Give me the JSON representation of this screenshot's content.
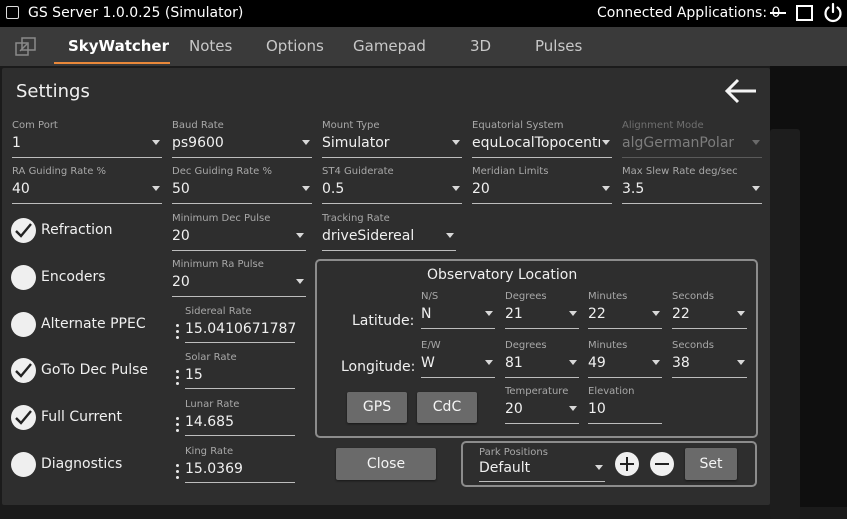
{
  "window": {
    "title": "GS Server 1.0.0.25 (Simulator)",
    "connected_label": "Connected Applications: 0"
  },
  "nav": {
    "tabs": [
      "SkyWatcher",
      "Notes",
      "Options",
      "Gamepad",
      "3D",
      "Pulses"
    ],
    "active": "SkyWatcher",
    "accent_color": "#e9883a"
  },
  "panel": {
    "title": "Settings"
  },
  "fields": {
    "com_port": {
      "label": "Com Port",
      "value": "1"
    },
    "baud_rate": {
      "label": "Baud Rate",
      "value": "ps9600"
    },
    "mount_type": {
      "label": "Mount Type",
      "value": "Simulator"
    },
    "equatorial_system": {
      "label": "Equatorial System",
      "value": "equLocalTopocentri"
    },
    "alignment_mode": {
      "label": "Alignment Mode",
      "value": "algGermanPolar"
    },
    "ra_guiding_rate": {
      "label": "RA Guiding Rate %",
      "value": "40"
    },
    "dec_guiding_rate": {
      "label": "Dec Guiding Rate %",
      "value": "50"
    },
    "st4_guiderate": {
      "label": "ST4 Guiderate",
      "value": "0.5"
    },
    "meridian_limits": {
      "label": "Meridian Limits",
      "value": "20"
    },
    "max_slew_rate": {
      "label": "Max Slew Rate deg/sec",
      "value": "3.5"
    },
    "min_dec_pulse": {
      "label": "Minimum Dec Pulse",
      "value": "20"
    },
    "tracking_rate": {
      "label": "Tracking Rate",
      "value": "driveSidereal"
    },
    "min_ra_pulse": {
      "label": "Minimum Ra Pulse",
      "value": "20"
    },
    "sidereal_rate": {
      "label": "Sidereal Rate",
      "value": "15.0410671787"
    },
    "solar_rate": {
      "label": "Solar Rate",
      "value": "15"
    },
    "lunar_rate": {
      "label": "Lunar Rate",
      "value": "14.685"
    },
    "king_rate": {
      "label": "King Rate",
      "value": "15.0369"
    }
  },
  "checkboxes": [
    {
      "label": "Refraction",
      "checked": true
    },
    {
      "label": "Encoders",
      "checked": false
    },
    {
      "label": "Alternate PPEC",
      "checked": false
    },
    {
      "label": "GoTo Dec Pulse",
      "checked": true
    },
    {
      "label": "Full Current",
      "checked": true
    },
    {
      "label": "Diagnostics",
      "checked": false
    }
  ],
  "observatory": {
    "title": "Observatory Location",
    "latitude": {
      "label": "Latitude:",
      "ns": {
        "label": "N/S",
        "value": "N"
      },
      "degrees": {
        "label": "Degrees",
        "value": "21"
      },
      "minutes": {
        "label": "Minutes",
        "value": "22"
      },
      "seconds": {
        "label": "Seconds",
        "value": "22"
      }
    },
    "longitude": {
      "label": "Longitude:",
      "ew": {
        "label": "E/W",
        "value": "W"
      },
      "degrees": {
        "label": "Degrees",
        "value": "81"
      },
      "minutes": {
        "label": "Minutes",
        "value": "49"
      },
      "seconds": {
        "label": "Seconds",
        "value": "38"
      }
    },
    "gps_button": "GPS",
    "cdc_button": "CdC",
    "temperature": {
      "label": "Temperature",
      "value": "20"
    },
    "elevation": {
      "label": "Elevation",
      "value": "10"
    }
  },
  "close_button": "Close",
  "park": {
    "label": "Park Positions",
    "value": "Default",
    "set_button": "Set"
  }
}
